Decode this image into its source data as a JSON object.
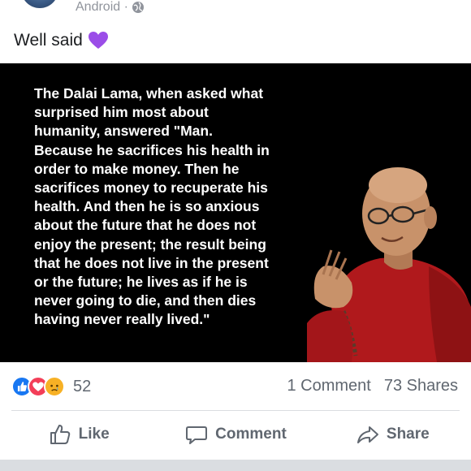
{
  "post": {
    "meta_text": "Android ·",
    "text": "Well said",
    "text_emoji": "purple-heart-icon",
    "image_quote": "The Dalai Lama, when asked what\nsurprised him most about\nhumanity, answered \"Man.\nBecause he sacrifices his health in\norder to make money. Then he\nsacrifices money to recuperate his\nhealth. And then he is so anxious\nabout the future that he does not\nenjoy the present; the result being\nthat he does not live in the present\nor the future; he lives as if he is\nnever going to die, and then dies\nhaving never really lived.\""
  },
  "stats": {
    "reaction_icons": [
      "like-icon",
      "love-icon",
      "sad-icon"
    ],
    "reaction_count": "52",
    "comments": "1 Comment",
    "shares": "73 Shares"
  },
  "actions": {
    "like": "Like",
    "comment": "Comment",
    "share": "Share"
  },
  "colors": {
    "like_blue": "#1877f2",
    "love_red": "#f33e58",
    "sad_yellow": "#f7b125",
    "heart_purple": "#9b4de8",
    "robe_red": "#b0191c"
  }
}
